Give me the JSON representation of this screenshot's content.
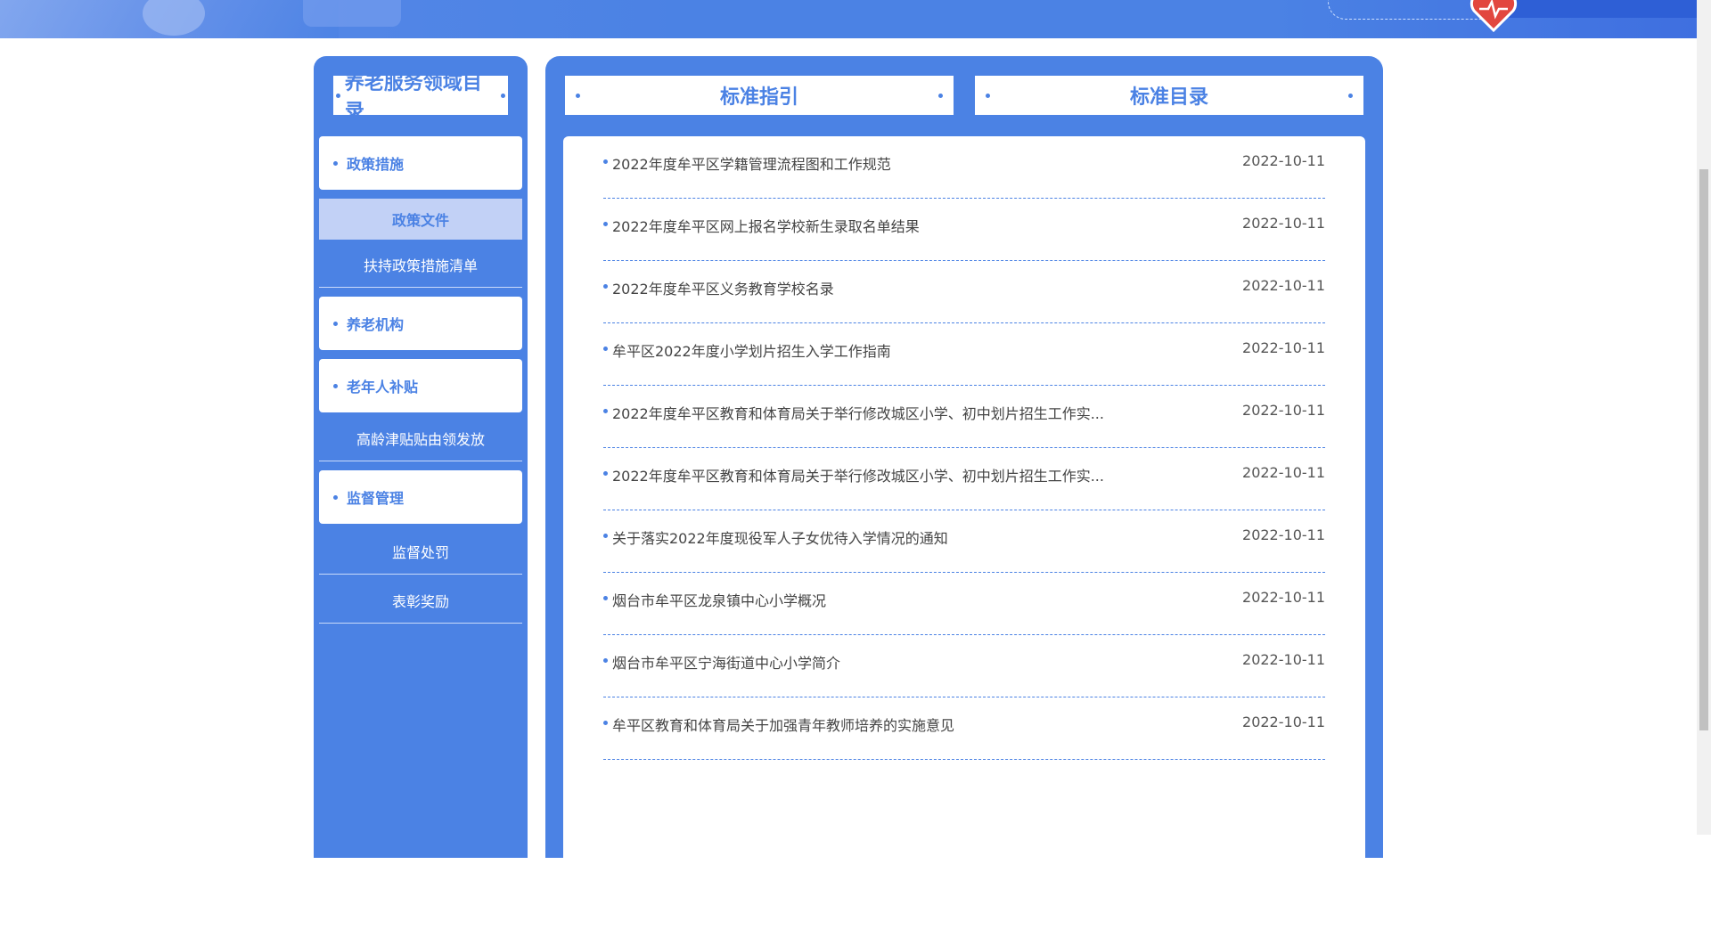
{
  "sidebar": {
    "title": "养老服务领域目录",
    "items": [
      {
        "type": "category",
        "label": "政策措施"
      },
      {
        "type": "sub",
        "label": "政策文件",
        "active": true
      },
      {
        "type": "sub",
        "label": "扶持政策措施清单"
      },
      {
        "type": "category",
        "label": "养老机构"
      },
      {
        "type": "category",
        "label": "老年人补贴"
      },
      {
        "type": "sub",
        "label": "高龄津贴贴由领发放"
      },
      {
        "type": "category",
        "label": "监督管理"
      },
      {
        "type": "sub",
        "label": "监督处罚"
      },
      {
        "type": "sub",
        "label": "表彰奖励"
      }
    ]
  },
  "tabs": [
    {
      "label": "标准指引"
    },
    {
      "label": "标准目录"
    }
  ],
  "articles": [
    {
      "title": "2022年度牟平区学籍管理流程图和工作规范",
      "date": "2022-10-11"
    },
    {
      "title": "2022年度牟平区网上报名学校新生录取名单结果",
      "date": "2022-10-11"
    },
    {
      "title": "2022年度牟平区义务教育学校名录",
      "date": "2022-10-11"
    },
    {
      "title": "牟平区2022年度小学划片招生入学工作指南",
      "date": "2022-10-11"
    },
    {
      "title": "2022年度牟平区教育和体育局关于举行修改城区小学、初中划片招生工作实...",
      "date": "2022-10-11"
    },
    {
      "title": "2022年度牟平区教育和体育局关于举行修改城区小学、初中划片招生工作实...",
      "date": "2022-10-11"
    },
    {
      "title": "关于落实2022年度现役军人子女优待入学情况的通知",
      "date": "2022-10-11"
    },
    {
      "title": "烟台市牟平区龙泉镇中心小学概况",
      "date": "2022-10-11"
    },
    {
      "title": "烟台市牟平区宁海街道中心小学简介",
      "date": "2022-10-11"
    },
    {
      "title": "牟平区教育和体育局关于加强青年教师培养的实施意见",
      "date": "2022-10-11"
    }
  ],
  "colors": {
    "accent": "#4b82e4",
    "active_bg": "#c2d1f6",
    "heart": "#e2473f"
  }
}
